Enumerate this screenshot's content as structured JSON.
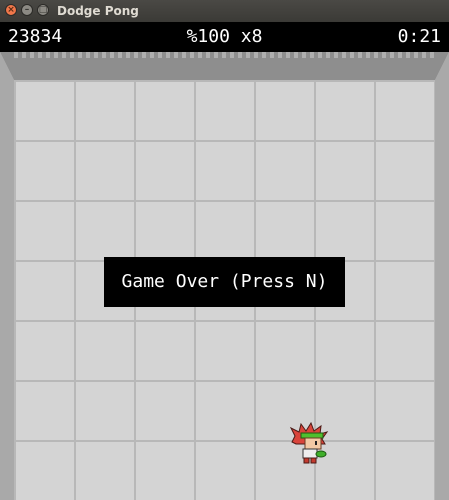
{
  "window": {
    "title": "Dodge Pong",
    "controls": {
      "close": "×",
      "minimize": "–",
      "maximize": "□"
    }
  },
  "hud": {
    "score": "23834",
    "status": "%100 x8",
    "time": "0:21"
  },
  "game": {
    "overlay_text": "Game Over (Press N)",
    "player_sprite": "red-haired-character-with-green-headband"
  },
  "colors": {
    "floor": "#d4d4d4",
    "grid_line": "#b8b8b8",
    "wall": "#8e8e8e",
    "hud_background": "#000000",
    "hud_text": "#ffffff"
  }
}
